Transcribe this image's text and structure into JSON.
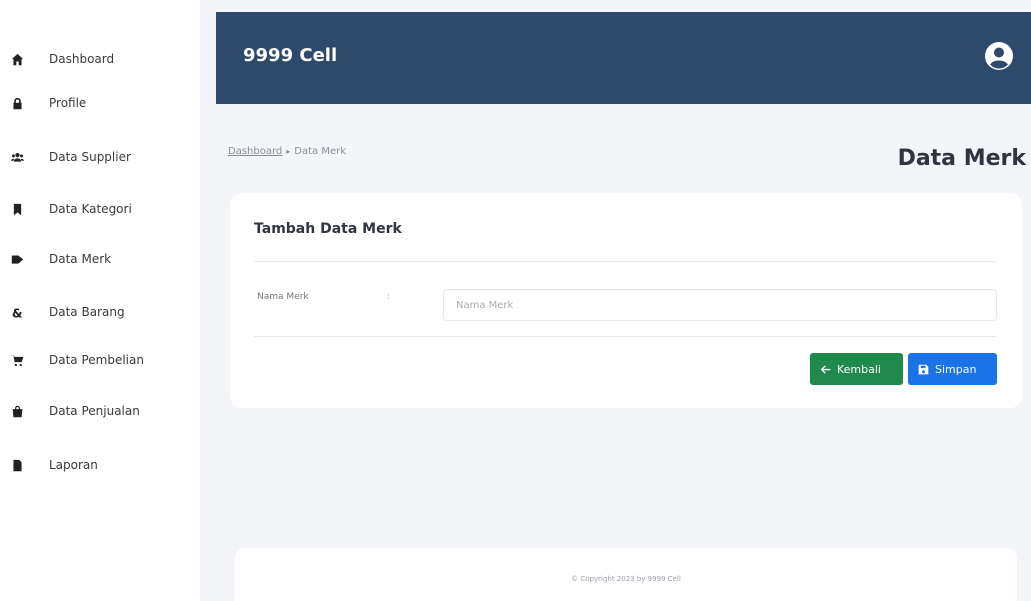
{
  "sidebar": {
    "items": [
      {
        "label": "Dashboard",
        "icon": "home-icon"
      },
      {
        "label": "Profile",
        "icon": "lock-icon"
      },
      {
        "label": "Data Supplier",
        "icon": "users-icon"
      },
      {
        "label": "Data Kategori",
        "icon": "bookmark-icon"
      },
      {
        "label": "Data Merk",
        "icon": "tag-icon"
      },
      {
        "label": "Data Barang",
        "icon": "ampersand-icon"
      },
      {
        "label": "Data Pembelian",
        "icon": "cart-icon"
      },
      {
        "label": "Data Penjualan",
        "icon": "bag-icon"
      },
      {
        "label": "Laporan",
        "icon": "file-icon"
      }
    ]
  },
  "header": {
    "brand": "9999 Cell",
    "user_icon": "user-circle-icon",
    "background": "#2e4a6b"
  },
  "breadcrumb": {
    "home": "Dashboard",
    "separator": "▸",
    "current": "Data Merk"
  },
  "page": {
    "title": "Data Merk"
  },
  "form": {
    "title": "Tambah Data Merk",
    "field_label": "Nama Merk",
    "field_colon": ":",
    "field_placeholder": "Nama Merk",
    "field_value": ""
  },
  "buttons": {
    "back_label": "Kembali",
    "back_icon": "arrow-left-icon",
    "back_color": "#1f8a4c",
    "save_label": "Simpan",
    "save_icon": "floppy-disk-icon",
    "save_color": "#1a73e8"
  },
  "footer": {
    "text": "© Copyright 2023 by 9999 Cell"
  }
}
